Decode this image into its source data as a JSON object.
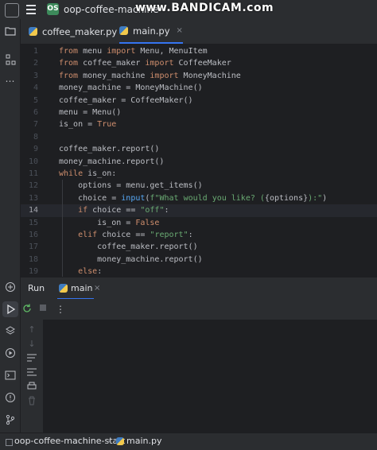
{
  "titlebar": {
    "project_badge": "OS",
    "project_name": "oop-coffee-machine-",
    "watermark": "www.BANDICAM.com"
  },
  "tabs": [
    {
      "label": "coffee_maker.py",
      "active": false
    },
    {
      "label": "main.py",
      "active": true,
      "close": "×"
    }
  ],
  "editor": {
    "lines": [
      {
        "n": "1",
        "html": "<span class='kw'>from</span> menu <span class='kw'>import</span> Menu, MenuItem"
      },
      {
        "n": "2",
        "html": "<span class='kw'>from</span> coffee_maker <span class='kw'>import</span> CoffeeMaker"
      },
      {
        "n": "3",
        "html": "<span class='kw'>from</span> money_machine <span class='kw'>import</span> MoneyMachine"
      },
      {
        "n": "4",
        "html": "money_machine = MoneyMachine()"
      },
      {
        "n": "5",
        "html": "coffee_maker = CoffeeMaker()"
      },
      {
        "n": "6",
        "html": "menu = Menu()"
      },
      {
        "n": "7",
        "html": "is_on = <span class='kw'>True</span>"
      },
      {
        "n": "8",
        "html": ""
      },
      {
        "n": "9",
        "html": "coffee_maker.report()"
      },
      {
        "n": "10",
        "html": "money_machine.report()"
      },
      {
        "n": "11",
        "html": "<span class='kw'>while</span> is_on:"
      },
      {
        "n": "12",
        "html": "    options = menu.get_items()"
      },
      {
        "n": "13",
        "html": "    choice = <span class='fn'>input</span>(<span class='str'>f\"What would you like? (</span>{options}<span class='str'>):\"</span>)"
      },
      {
        "n": "14",
        "html": "    <span class='kw'>if</span> choice == <span class='str'>\"off\"</span>:",
        "current": true
      },
      {
        "n": "15",
        "html": "        is_on = <span class='kw'>False</span>"
      },
      {
        "n": "16",
        "html": "    <span class='kw'>elif</span> choice == <span class='str'>\"report\"</span>:"
      },
      {
        "n": "17",
        "html": "        coffee_maker.report()"
      },
      {
        "n": "18",
        "html": "        money_machine.report()"
      },
      {
        "n": "19",
        "html": "    <span class='kw'>else</span>:"
      }
    ]
  },
  "run_panel": {
    "title": "Run",
    "tab_label": "main",
    "close": "×",
    "kebab": "⋮"
  },
  "statusbar": {
    "project": "oop-coffee-machine-start",
    "separator": "›",
    "file": "main.py"
  },
  "colors": {
    "background": "#1e1f22",
    "panel": "#2b2d30",
    "keyword": "#cf8e6d",
    "string": "#6aab73",
    "function": "#56a8f5",
    "accent": "#3574f0"
  },
  "icons": [
    "menu-icon",
    "folder-icon",
    "structure-icon",
    "more-icon",
    "python-icon",
    "run-icon",
    "rerun-icon",
    "stop-icon",
    "layers-icon",
    "debug-icon",
    "terminal-icon",
    "problems-icon",
    "git-icon",
    "scroll-up-icon",
    "scroll-down-icon",
    "soft-wrap-icon",
    "scroll-end-icon",
    "print-icon",
    "trash-icon"
  ]
}
